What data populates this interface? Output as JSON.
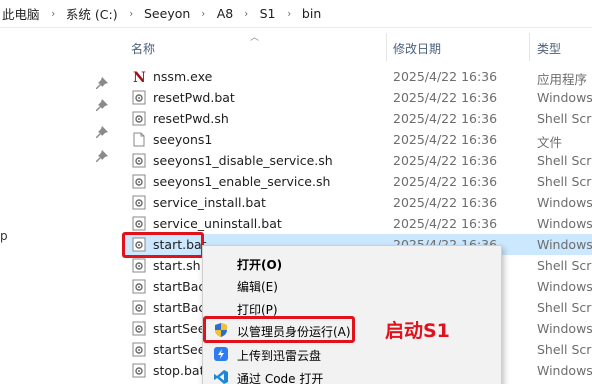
{
  "breadcrumb": {
    "items": [
      "此电脑",
      "系统 (C:)",
      "Seeyon",
      "A8",
      "S1",
      "bin"
    ],
    "separator": "›"
  },
  "nav_fragment": "p",
  "columns": {
    "name": "名称",
    "date": "修改日期",
    "type": "类型"
  },
  "files": [
    {
      "name": "nssm.exe",
      "date": "2025/4/22 16:36",
      "type": "应用程序",
      "icon": "exe-icon"
    },
    {
      "name": "resetPwd.bat",
      "date": "2025/4/22 16:36",
      "type": "Windows",
      "icon": "gear-file-icon"
    },
    {
      "name": "resetPwd.sh",
      "date": "2025/4/22 16:36",
      "type": "Shell Scrip",
      "icon": "gear-file-icon"
    },
    {
      "name": "seeyons1",
      "date": "2025/4/22 16:36",
      "type": "文件",
      "icon": "blank-file-icon"
    },
    {
      "name": "seeyons1_disable_service.sh",
      "date": "2025/4/22 16:36",
      "type": "Shell Scrip",
      "icon": "gear-file-icon"
    },
    {
      "name": "seeyons1_enable_service.sh",
      "date": "2025/4/22 16:36",
      "type": "Shell Scrip",
      "icon": "gear-file-icon"
    },
    {
      "name": "service_install.bat",
      "date": "2025/4/22 16:36",
      "type": "Windows",
      "icon": "gear-file-icon"
    },
    {
      "name": "service_uninstall.bat",
      "date": "2025/4/22 16:36",
      "type": "Windows",
      "icon": "gear-file-icon"
    },
    {
      "name": "start.bat",
      "date": "2025/4/22 16:36",
      "type": "Windows",
      "icon": "gear-file-icon"
    },
    {
      "name": "start.sh",
      "date": "",
      "type": "Shell Scrip",
      "icon": "gear-file-icon"
    },
    {
      "name": "startBac",
      "date": "",
      "type": "Windows",
      "icon": "gear-file-icon"
    },
    {
      "name": "startBac",
      "date": "",
      "type": "Shell Scrip",
      "icon": "gear-file-icon"
    },
    {
      "name": "startSee",
      "date": "",
      "type": "Windows",
      "icon": "gear-file-icon"
    },
    {
      "name": "startSeey",
      "date": "",
      "type": "Shell Scrip",
      "icon": "gear-file-icon"
    },
    {
      "name": "stop.bat",
      "date": "",
      "type": "Windows",
      "icon": "gear-file-icon"
    }
  ],
  "context_menu": {
    "items": [
      {
        "label": "打开(O)",
        "icon": ""
      },
      {
        "label": "编辑(E)",
        "icon": ""
      },
      {
        "label": "打印(P)",
        "icon": ""
      },
      {
        "label": "以管理员身份运行(A)",
        "icon": "uac-shield-icon"
      },
      {
        "label": "上传到迅雷云盘",
        "icon": "thunder-cloud-icon"
      },
      {
        "label": "通过 Code 打开",
        "icon": "vscode-icon"
      }
    ]
  },
  "annotation": "启动S1",
  "colors": {
    "highlight_red": "#e0121b",
    "selection": "#cce8ff",
    "vscode_blue": "#1e88d8"
  }
}
